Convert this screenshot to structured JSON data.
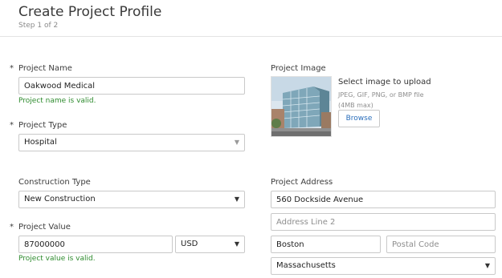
{
  "header": {
    "title": "Create Project Profile",
    "step": "Step 1 of 2"
  },
  "required_marker": "*",
  "project_name": {
    "label": "Project Name",
    "value": "Oakwood Medical",
    "validation": "Project name is valid."
  },
  "project_type": {
    "label": "Project Type",
    "value": "Hospital"
  },
  "construction_type": {
    "label": "Construction Type",
    "value": "New Construction"
  },
  "project_value": {
    "label": "Project Value",
    "value": "87000000",
    "currency": "USD",
    "validation": "Project value is valid."
  },
  "project_image": {
    "label": "Project Image",
    "upload_title": "Select image to upload",
    "hint_line1": "JPEG, GIF, PNG, or BMP file",
    "hint_line2": "(4MB max)",
    "browse_label": "Browse"
  },
  "project_address": {
    "label": "Project Address",
    "line1": "560 Dockside Avenue",
    "line2_placeholder": "Address Line 2",
    "city": "Boston",
    "postal_placeholder": "Postal Code",
    "state": "Massachusetts"
  },
  "colors": {
    "valid_text": "#2e8b2e",
    "link_blue": "#2a6ebb",
    "border": "#c9c9c9"
  }
}
